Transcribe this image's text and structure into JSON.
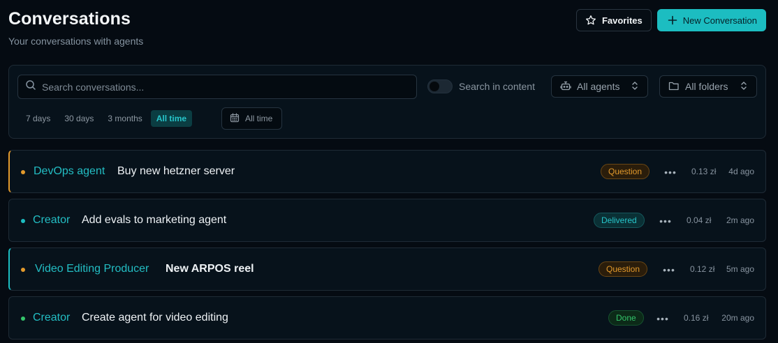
{
  "header": {
    "title": "Conversations",
    "subtitle": "Your conversations with agents",
    "favorites_label": "Favorites",
    "new_label": "New Conversation"
  },
  "filters": {
    "search_placeholder": "Search conversations...",
    "search_value": "",
    "search_in_content_label": "Search in content",
    "search_in_content_on": false,
    "agents_label": "All agents",
    "folders_label": "All folders",
    "ranges": [
      "7 days",
      "30 days",
      "3 months",
      "All time"
    ],
    "active_range": "All time",
    "date_picker_label": "All time"
  },
  "colors": {
    "accent": "#1cbdc1",
    "question": "#e39a2c",
    "delivered": "#27c6cb",
    "done": "#34c56b"
  },
  "conversations": [
    {
      "agent": "DevOps agent",
      "title": "Buy new hetzner server",
      "status": "Question",
      "cost": "0.13 zł",
      "age": "4d ago"
    },
    {
      "agent": "Creator",
      "title": "Add evals to marketing agent",
      "status": "Delivered",
      "cost": "0.04 zł",
      "age": "2m ago"
    },
    {
      "agent": "Video Editing Producer",
      "title": "New ARPOS reel",
      "status": "Question",
      "cost": "0.12 zł",
      "age": "5m ago"
    },
    {
      "agent": "Creator",
      "title": "Create agent for video editing",
      "status": "Done",
      "cost": "0.16 zł",
      "age": "20m ago"
    }
  ]
}
